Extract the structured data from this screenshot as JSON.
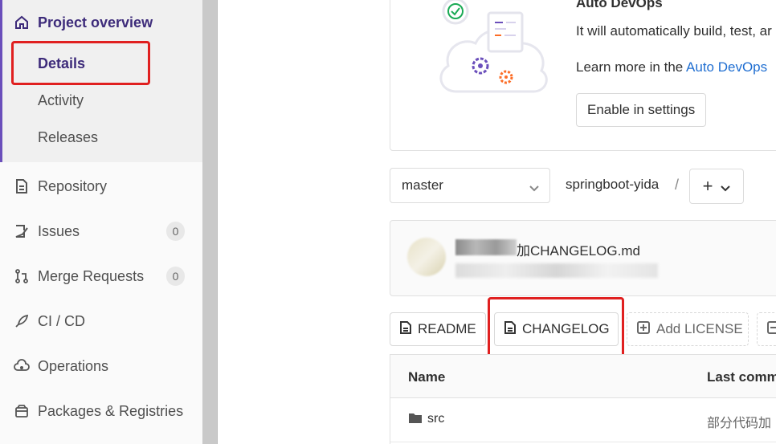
{
  "sidebar": {
    "project_overview": "Project overview",
    "details": "Details",
    "activity": "Activity",
    "releases": "Releases",
    "repository": "Repository",
    "issues": "Issues",
    "issues_count": "0",
    "merge_requests": "Merge Requests",
    "merge_requests_count": "0",
    "cicd": "CI / CD",
    "operations": "Operations",
    "packages": "Packages & Registries"
  },
  "devops": {
    "title": "Auto DevOps",
    "text": "It will automatically build, test, ar",
    "learn_prefix": "Learn more in the ",
    "learn_link": "Auto DevOps",
    "enable_button": "Enable in settings"
  },
  "repo": {
    "branch": "master",
    "project": "springboot-yida",
    "separator": "/",
    "add_icon": "+"
  },
  "commit": {
    "title": "加CHANGELOG.md"
  },
  "file_buttons": {
    "readme": "README",
    "changelog": "CHANGELOG",
    "add_license": "Add LICENSE"
  },
  "table": {
    "col_name": "Name",
    "col_last_commit": "Last comm",
    "rows": [
      {
        "name": "src",
        "commit": "部分代码加"
      }
    ]
  },
  "colors": {
    "accent": "#6b4fbb",
    "highlight": "#e02020",
    "link": "#1f6ed1"
  }
}
